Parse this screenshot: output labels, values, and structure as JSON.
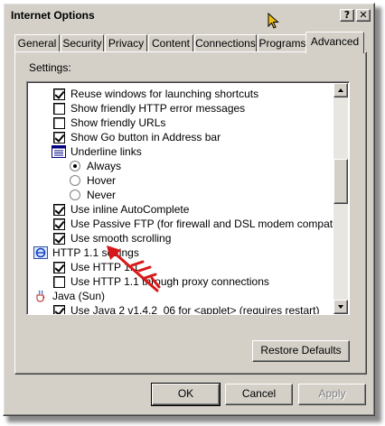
{
  "window": {
    "title": "Internet Options",
    "help_label": "?",
    "close_label": "✕"
  },
  "tabs": [
    {
      "label": "General"
    },
    {
      "label": "Security"
    },
    {
      "label": "Privacy"
    },
    {
      "label": "Content"
    },
    {
      "label": "Connections"
    },
    {
      "label": "Programs"
    },
    {
      "label": "Advanced",
      "active": true
    }
  ],
  "settings_label": "Settings:",
  "settings": [
    {
      "kind": "checkbox",
      "checked": true,
      "label": "Reuse windows for launching shortcuts"
    },
    {
      "kind": "checkbox",
      "checked": false,
      "label": "Show friendly HTTP error messages"
    },
    {
      "kind": "checkbox",
      "checked": false,
      "label": "Show friendly URLs"
    },
    {
      "kind": "checkbox",
      "checked": true,
      "label": "Show Go button in Address bar"
    },
    {
      "kind": "group",
      "icon": "list-icon",
      "label": "Underline links"
    },
    {
      "kind": "radio",
      "checked": true,
      "label": "Always"
    },
    {
      "kind": "radio",
      "checked": false,
      "label": "Hover"
    },
    {
      "kind": "radio",
      "checked": false,
      "label": "Never"
    },
    {
      "kind": "checkbox",
      "checked": true,
      "label": "Use inline AutoComplete"
    },
    {
      "kind": "checkbox",
      "checked": true,
      "label": "Use Passive FTP (for firewall and DSL modem compatibility)"
    },
    {
      "kind": "checkbox",
      "checked": true,
      "label": "Use smooth scrolling"
    },
    {
      "kind": "category",
      "icon": "ie-globe-icon",
      "label": "HTTP 1.1 settings"
    },
    {
      "kind": "checkbox",
      "checked": true,
      "label": "Use HTTP 1.1"
    },
    {
      "kind": "checkbox",
      "checked": false,
      "label": "Use HTTP 1.1 through proxy connections"
    },
    {
      "kind": "category",
      "icon": "java-cup-icon",
      "label": "Java (Sun)"
    },
    {
      "kind": "checkbox",
      "checked": true,
      "label": "Use Java 2 v1.4.2_06 for <applet> (requires restart)"
    }
  ],
  "buttons": {
    "restore_defaults": "Restore Defaults",
    "ok": "OK",
    "cancel": "Cancel",
    "apply": "Apply"
  },
  "annotation": {
    "icon": "red-arrow-annotation",
    "color": "#d81818"
  }
}
